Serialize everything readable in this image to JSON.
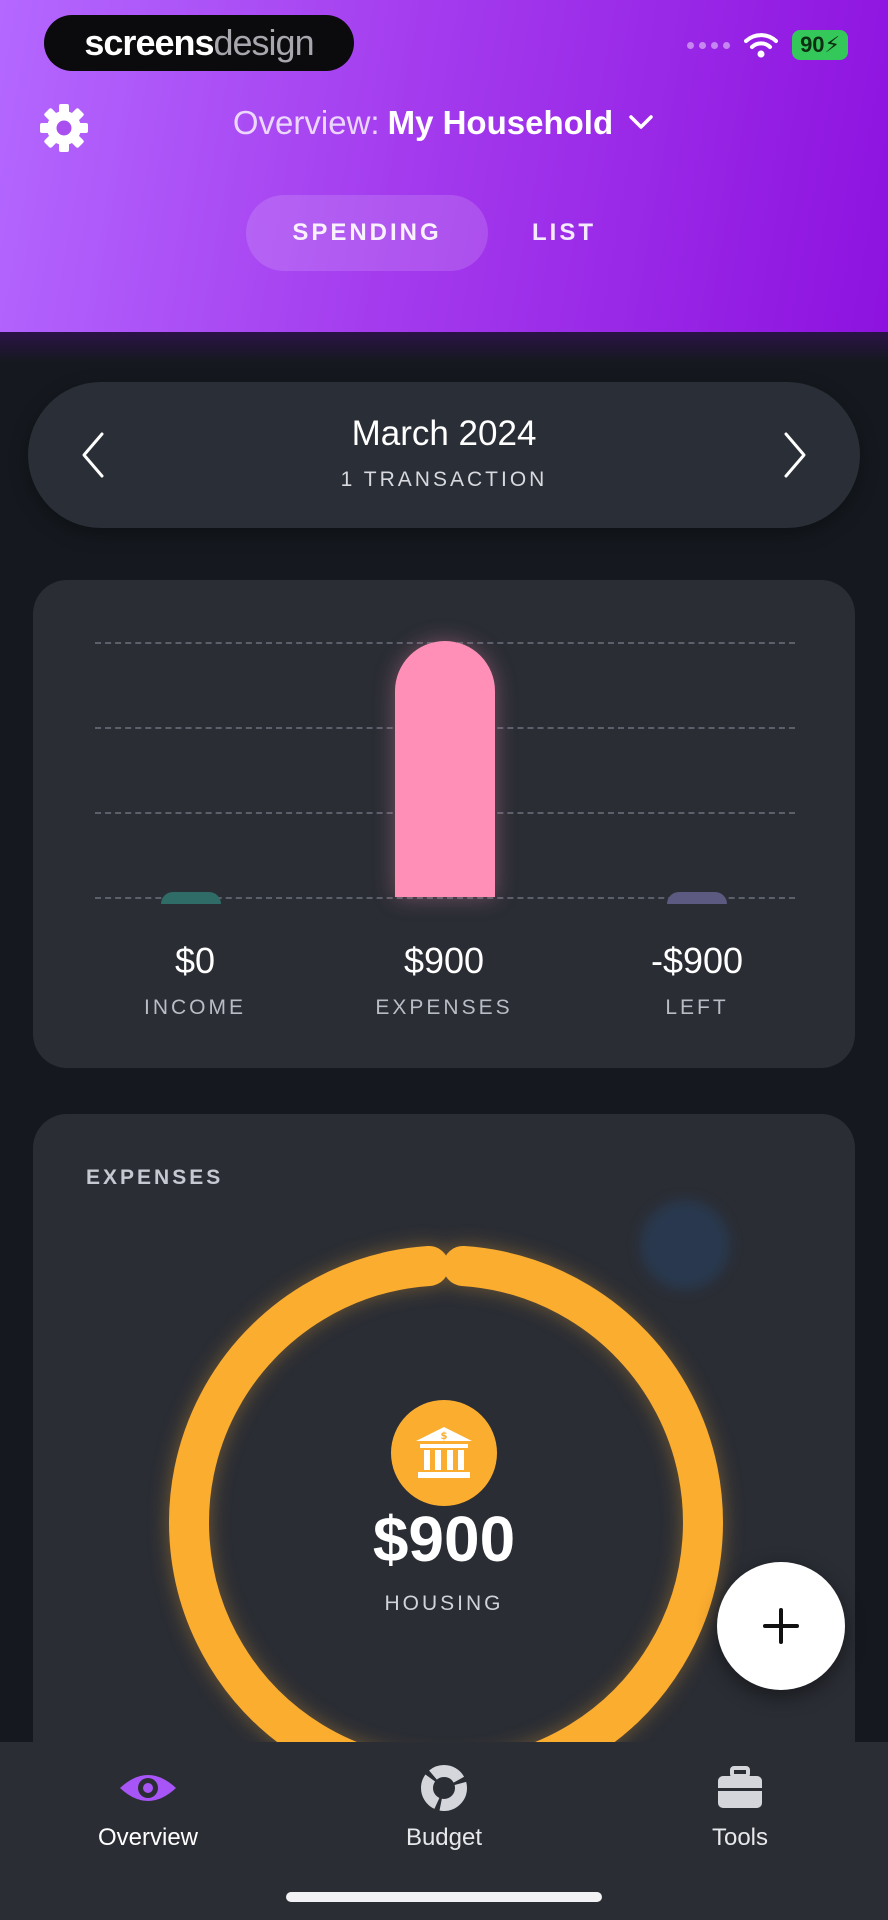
{
  "brand": {
    "part1": "screens",
    "part2": "design"
  },
  "status_bar": {
    "battery": "90"
  },
  "header": {
    "title_prefix": "Overview:",
    "title_value": "My Household",
    "tabs": [
      {
        "label": "SPENDING",
        "active": true
      },
      {
        "label": "LIST",
        "active": false
      }
    ]
  },
  "period": {
    "month": "March 2024",
    "transactions": "1 TRANSACTION"
  },
  "summary": {
    "income": {
      "value": "$0",
      "label": "INCOME"
    },
    "expenses": {
      "value": "$900",
      "label": "EXPENSES"
    },
    "left": {
      "value": "-$900",
      "label": "LEFT"
    }
  },
  "chart_data": {
    "type": "bar",
    "categories": [
      "INCOME",
      "EXPENSES",
      "LEFT"
    ],
    "values": [
      0,
      900,
      -900
    ],
    "colors": [
      "#2f6b67",
      "#ff8fb6",
      "#5c5a80"
    ]
  },
  "expenses_card": {
    "heading": "EXPENSES",
    "amount": "$900",
    "category": "HOUSING",
    "category_icon": "bank-icon",
    "ring_color": "#fbad30"
  },
  "nav": {
    "items": [
      {
        "label": "Overview",
        "icon": "eye-icon",
        "active": true
      },
      {
        "label": "Budget",
        "icon": "donut-chart-icon",
        "active": false
      },
      {
        "label": "Tools",
        "icon": "toolbox-icon",
        "active": false
      }
    ]
  },
  "colors": {
    "accent": "#a43cee",
    "background": "#15191f",
    "card": "#2a2d34"
  }
}
